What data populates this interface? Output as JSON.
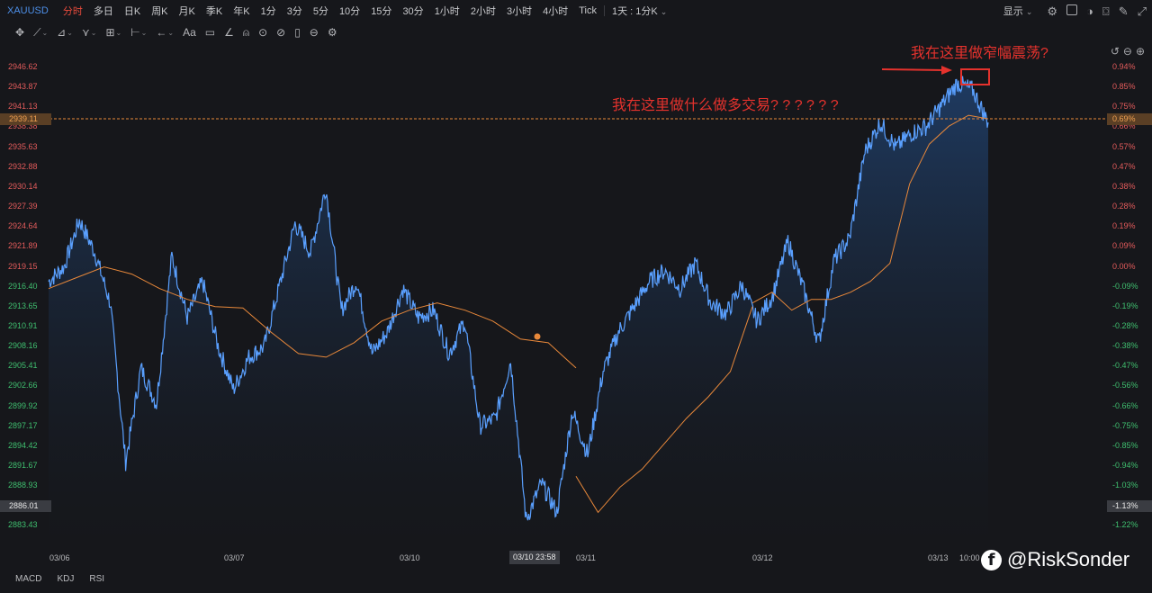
{
  "toolbar": {
    "symbol": "XAUUSD",
    "timeframes": [
      "分时",
      "多日",
      "日K",
      "周K",
      "月K",
      "季K",
      "年K",
      "1分",
      "3分",
      "5分",
      "10分",
      "15分",
      "30分",
      "1小时",
      "2小时",
      "3小时",
      "4小时",
      "Tick"
    ],
    "active_timeframe": "分时",
    "range_select": "1天 : 1分K",
    "display_label": "显示",
    "icons": [
      "settings-icon",
      "checkbox-icon",
      "theme-icon",
      "camera-icon",
      "pen-icon",
      "fullscreen-icon"
    ]
  },
  "draw_tools": [
    "crosshair-icon",
    "line-icon",
    "channel-icon",
    "pattern-icon",
    "fib-icon",
    "measure-icon",
    "arrow-icon",
    "text-icon",
    "note-icon",
    "brush-icon",
    "magnet-icon",
    "lock-icon",
    "hide-icon",
    "trash-icon",
    "link-icon",
    "gear-icon"
  ],
  "draw_text_label": "Aa",
  "price_axis": {
    "labels": [
      "2946.62",
      "2943.87",
      "2941.13",
      "2938.38",
      "2935.63",
      "2932.88",
      "2930.14",
      "2927.39",
      "2924.64",
      "2921.89",
      "2919.15",
      "2916.40",
      "2913.65",
      "2910.91",
      "2908.16",
      "2905.41",
      "2902.66",
      "2899.92",
      "2897.17",
      "2894.42",
      "2891.67",
      "2888.93",
      "2886.18",
      "2883.43"
    ],
    "current_price": "2939.11",
    "hover_price": "2886.01"
  },
  "pct_axis": {
    "labels": [
      "0.94%",
      "0.85%",
      "0.75%",
      "0.66%",
      "0.57%",
      "0.47%",
      "0.38%",
      "0.28%",
      "0.19%",
      "0.09%",
      "0.00%",
      "-0.09%",
      "-0.19%",
      "-0.28%",
      "-0.38%",
      "-0.47%",
      "-0.56%",
      "-0.66%",
      "-0.75%",
      "-0.85%",
      "-0.94%",
      "-1.03%",
      "-1.13%",
      "-1.22%"
    ],
    "current_pct": "0.69%",
    "hover_pct": "-1.13%"
  },
  "date_axis": {
    "labels": [
      "03/06",
      "03/07",
      "03/10",
      "03/11",
      "03/12",
      "03/13",
      "10:00"
    ],
    "hover_time": "03/10 23:58"
  },
  "indicators": [
    "MACD",
    "KDJ",
    "RSI"
  ],
  "annotations": {
    "top": "我在这里做窄幅震荡?",
    "middle": "我在这里做什么做多交易? ? ? ? ? ?"
  },
  "watermark": "@RiskSonder",
  "colors": {
    "price_line": "#5aa0ff",
    "avg_line": "#e8883a",
    "up": "#e35b5b",
    "down": "#3fbf6f",
    "annotation": "#e5322d",
    "background": "#16171b"
  },
  "chart_data": {
    "type": "line",
    "symbol": "XAUUSD",
    "base_price": 2919.15,
    "ylim": [
      2883.43,
      2946.62
    ],
    "x": [
      "03/06",
      "03/07",
      "03/10",
      "03/11",
      "03/12",
      "03/13"
    ],
    "series": [
      {
        "price": [
          2917.0,
          2919.0,
          2925.5,
          2921.0,
          2914.0,
          2892.0,
          2905.0,
          2900.0,
          2920.5,
          2912.0,
          2917.0,
          2908.0,
          2902.0,
          2906.5,
          2908.0,
          2916.5,
          2925.0,
          2921.0,
          2930.0,
          2913.0,
          2917.0,
          2907.0,
          2910.0,
          2916.0,
          2912.0,
          2913.0,
          2907.0,
          2911.5,
          2897.0,
          2898.0,
          2906.0,
          2884.0,
          2889.0,
          2885.0,
          2899.0,
          2893.0,
          2904.5,
          2910.0,
          2913.5,
          2917.0,
          2918.5,
          2916.0,
          2919.5,
          2914.0,
          2912.5,
          2916.5,
          2911.5,
          2915.0,
          2922.5,
          2916.0,
          2908.5,
          2920.0,
          2923.0,
          2935.0,
          2939.0,
          2935.5,
          2937.5,
          2938.5,
          2941.5,
          2944.5,
          2943.5,
          2939.0
        ]
      },
      {
        "average": [
          2916.0,
          2917.5,
          2919.0,
          2918.0,
          2916.0,
          2914.5,
          2913.5,
          2913.3,
          2910.0,
          2907.0,
          2906.5,
          2908.5,
          2911.5,
          2913.0,
          2914.0,
          2913.0,
          2911.5,
          2909.0,
          2908.5,
          2905.0,
          2890.0,
          2885.0,
          2888.5,
          2891.0,
          2894.5,
          2898.0,
          2901.0,
          2904.5,
          2913.5,
          2914.0,
          2915.5,
          2913.0,
          2914.5,
          2914.5,
          2915.5,
          2917.0,
          2919.5,
          2930.5,
          2936.0,
          2938.5,
          2940.0,
          2939.5
        ]
      }
    ]
  }
}
